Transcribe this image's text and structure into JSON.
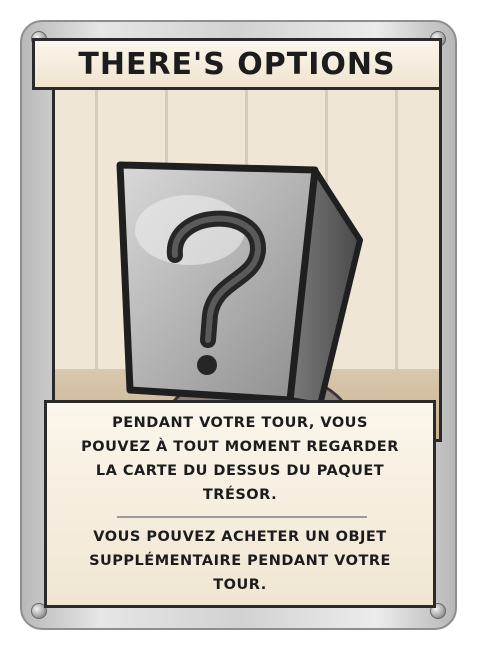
{
  "card": {
    "title": "THERE'S OPTIONS",
    "art_icon": "question-mark-box-icon",
    "effect_paragraphs": [
      "PENDANT VOTRE TOUR, VOUS\nPOUVEZ À TOUT MOMENT REGARDER\nLA CARTE DU DESSUS DU PAQUET\nTRÉSOR.",
      "VOUS POUVEZ ACHETER UN OBJET\nSUPPLÉMENTAIRE PENDANT VOTRE\nTOUR."
    ]
  },
  "colors": {
    "frame": "#d2d2d2",
    "parchment": "#f3ead9",
    "ink": "#1c1c1c",
    "box_gray": "#a9a9a9"
  }
}
